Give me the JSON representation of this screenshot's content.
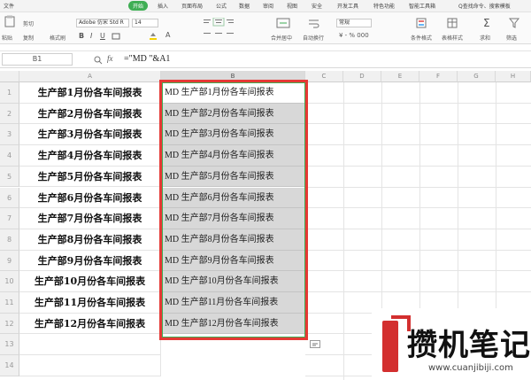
{
  "menu_tabs": [
    "文件",
    "开始",
    "插入",
    "页面布局",
    "公式",
    "数据",
    "审阅",
    "视图",
    "安全",
    "开发工具",
    "特色功能",
    "智能工具箱"
  ],
  "search": "Q查找命令、搜索模板",
  "ribbon": {
    "paste": "粘贴",
    "cut": "剪切",
    "copy": "复制",
    "format_painter": "格式刷",
    "font": "Adobe 仿宋 Std R",
    "size": "14",
    "merge": "合并居中",
    "wrap": "自动换行",
    "number_format": "常规",
    "cond_format": "条件格式",
    "table_style": "表格样式",
    "sum": "求和",
    "filter": "筛选"
  },
  "name_box": "B1",
  "fx": "fx",
  "formula": "=\"MD \"&A1",
  "columns": [
    "A",
    "B",
    "C",
    "D",
    "E",
    "F",
    "G",
    "H"
  ],
  "rows": [
    "1",
    "2",
    "3",
    "4",
    "5",
    "6",
    "7",
    "8",
    "9",
    "10",
    "11",
    "12",
    "13",
    "14"
  ],
  "colA": [
    "生产部1月份各车间报表",
    "生产部2月份各车间报表",
    "生产部3月份各车间报表",
    "生产部4月份各车间报表",
    "生产部5月份各车间报表",
    "生产部6月份各车间报表",
    "生产部7月份各车间报表",
    "生产部8月份各车间报表",
    "生产部9月份各车间报表",
    "生产部10月份各车间报表",
    "生产部11月份各车间报表",
    "生产部12月份各车间报表"
  ],
  "colB": [
    "MD 生产部1月份各车间报表",
    "MD 生产部2月份各车间报表",
    "MD 生产部3月份各车间报表",
    "MD 生产部4月份各车间报表",
    "MD 生产部5月份各车间报表",
    "MD 生产部6月份各车间报表",
    "MD 生产部7月份各车间报表",
    "MD 生产部8月份各车间报表",
    "MD 生产部9月份各车间报表",
    "MD 生产部10月份各车间报表",
    "MD 生产部11月份各车间报表",
    "MD 生产部12月份各车间报表"
  ],
  "watermark": {
    "title": "攒机笔记",
    "url": "www.cuanjibiji.com"
  },
  "colors": {
    "accent_green": "#3fae54",
    "selection_red": "#e53935",
    "fill_gray": "#d8d8d8"
  }
}
